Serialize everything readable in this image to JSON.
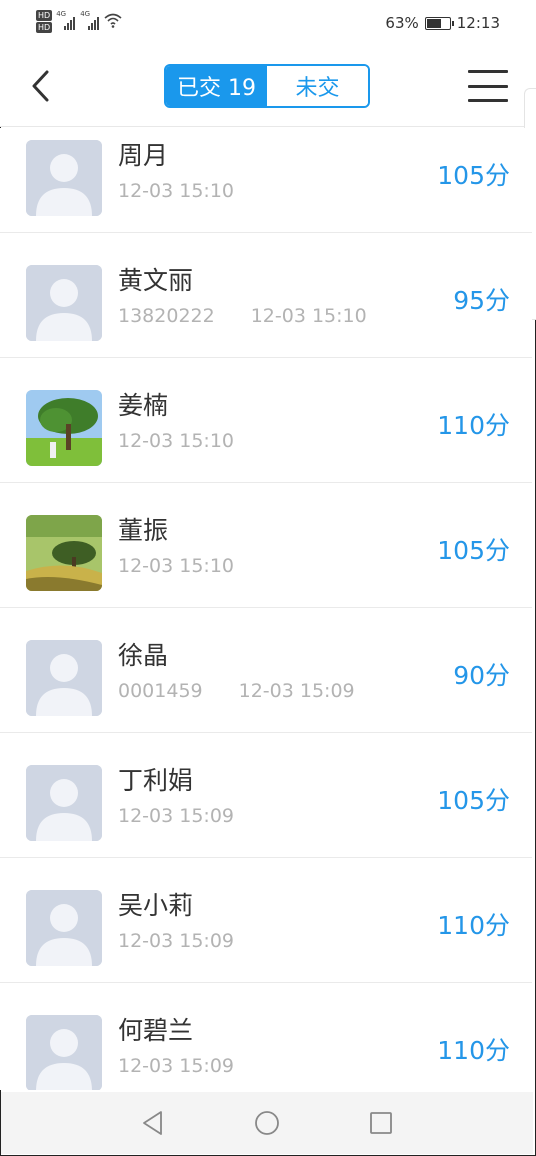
{
  "status_bar": {
    "signal_1_label": "4G",
    "signal_2_label": "4G",
    "hd_1": "HD",
    "hd_2": "HD",
    "battery_text": "63%",
    "battery_level": 0.63,
    "time": "12:13"
  },
  "header": {
    "tab_submitted": "已交 19",
    "tab_unsubmitted": "未交"
  },
  "students": [
    {
      "name": "周月",
      "student_id": "",
      "time": "12-03 15:10",
      "score": "105分",
      "avatar": "placeholder"
    },
    {
      "name": "黄文丽",
      "student_id": "13820222",
      "time": "12-03 15:10",
      "score": "95分",
      "avatar": "placeholder"
    },
    {
      "name": "姜楠",
      "student_id": "",
      "time": "12-03 15:10",
      "score": "110分",
      "avatar": "tree-photo"
    },
    {
      "name": "董振",
      "student_id": "",
      "time": "12-03 15:10",
      "score": "105分",
      "avatar": "landscape-photo"
    },
    {
      "name": "徐晶",
      "student_id": "0001459",
      "time": "12-03 15:09",
      "score": "90分",
      "avatar": "placeholder"
    },
    {
      "name": "丁利娟",
      "student_id": "",
      "time": "12-03 15:09",
      "score": "105分",
      "avatar": "placeholder"
    },
    {
      "name": "吴小莉",
      "student_id": "",
      "time": "12-03 15:09",
      "score": "110分",
      "avatar": "placeholder"
    },
    {
      "name": "何碧兰",
      "student_id": "",
      "time": "12-03 15:09",
      "score": "110分",
      "avatar": "placeholder"
    }
  ],
  "colors": {
    "accent": "#1a98ec",
    "score": "#2496e8",
    "placeholder_avatar": "#cfd6e3"
  },
  "icons": {
    "back": "back-chevron-icon",
    "menu": "hamburger-menu-icon",
    "nav_back": "nav-back-triangle-icon",
    "nav_home": "nav-home-circle-icon",
    "nav_recent": "nav-recent-square-icon"
  }
}
